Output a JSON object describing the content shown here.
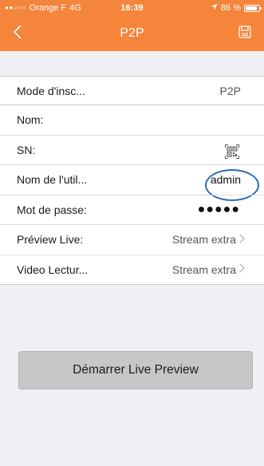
{
  "status_bar": {
    "signal": "●●○○○",
    "carrier": "Orange F",
    "network": "4G",
    "time": "16:39",
    "battery_label": "86 %",
    "battery_level": 0.86
  },
  "nav": {
    "title": "P2P",
    "back_icon": "chevron-left-icon",
    "save_icon": "save-icon"
  },
  "colors": {
    "header": "#f4853b",
    "background": "#efeff4",
    "highlight_circle": "#2a6ab3"
  },
  "form": {
    "mode": {
      "label": "Mode d'insc...",
      "value": "P2P"
    },
    "name": {
      "label": "Nom:",
      "value": ""
    },
    "sn": {
      "label": "SN:",
      "value": "",
      "icon": "qr-code-icon"
    },
    "username": {
      "label": "Nom de l'util...",
      "value": "admin"
    },
    "password": {
      "label": "Mot de passe:",
      "value": "●●●●●"
    },
    "preview_live": {
      "label": "Préview Live:",
      "value": "Stream extra"
    },
    "video_playback": {
      "label": "Video Lectur...",
      "value": "Stream extra"
    }
  },
  "start_button": "Démarrer Live Preview"
}
